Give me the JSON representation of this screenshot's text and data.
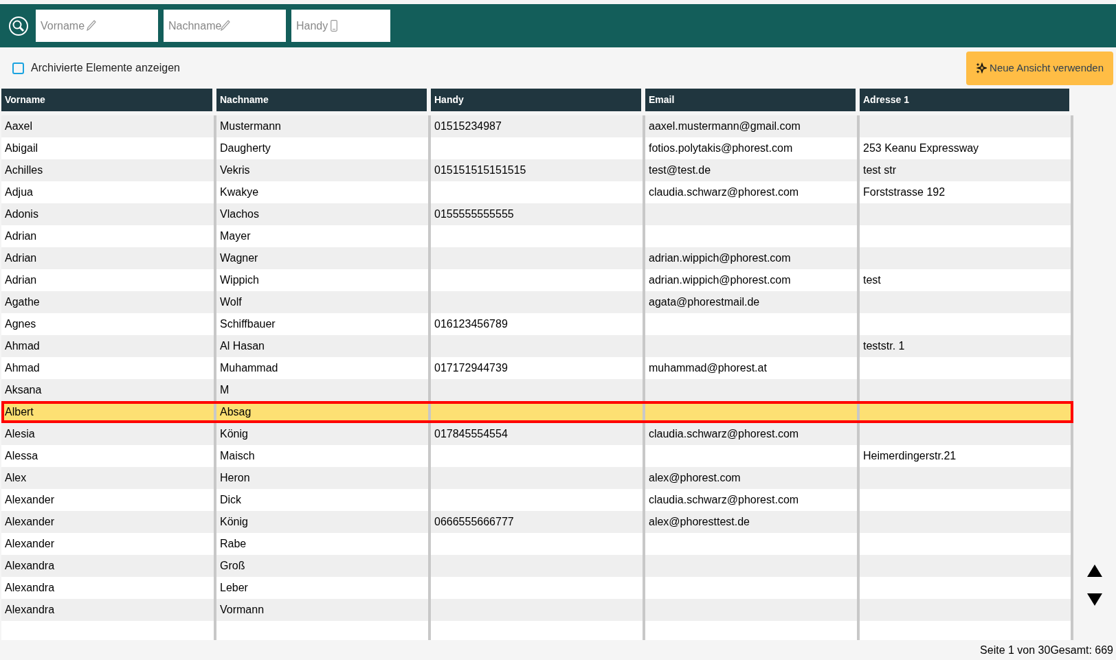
{
  "search": {
    "fields": [
      {
        "placeholder": "Vorname",
        "kind": "pencil"
      },
      {
        "placeholder": "Nachname",
        "kind": "pencil"
      },
      {
        "placeholder": "Handy",
        "kind": "phone"
      }
    ]
  },
  "archive_toggle": {
    "label": "Archivierte Elemente anzeigen",
    "checked": false
  },
  "new_view_button": {
    "label": "Neue Ansicht verwenden"
  },
  "table": {
    "columns": [
      "Vorname",
      "Nachname",
      "Handy",
      "Email",
      "Adresse 1"
    ],
    "rows": [
      {
        "cells": [
          "Aaxel",
          "Mustermann",
          "01515234987",
          "aaxel.mustermann@gmail.com",
          ""
        ],
        "selected": false
      },
      {
        "cells": [
          "Abigail",
          "Daugherty",
          "",
          "fotios.polytakis@phorest.com",
          "253 Keanu Expressway"
        ],
        "selected": false
      },
      {
        "cells": [
          "Achilles",
          "Vekris",
          "015151515151515",
          "test@test.de",
          "test str"
        ],
        "selected": false
      },
      {
        "cells": [
          "Adjua",
          "Kwakye",
          "",
          "claudia.schwarz@phorest.com",
          "Forststrasse 192"
        ],
        "selected": false
      },
      {
        "cells": [
          "Adonis",
          "Vlachos",
          "0155555555555",
          "",
          ""
        ],
        "selected": false
      },
      {
        "cells": [
          "Adrian",
          "Mayer",
          "",
          "",
          ""
        ],
        "selected": false
      },
      {
        "cells": [
          "Adrian",
          "Wagner",
          "",
          "adrian.wippich@phorest.com",
          ""
        ],
        "selected": false
      },
      {
        "cells": [
          "Adrian",
          "Wippich",
          "",
          "adrian.wippich@phorest.com",
          "test"
        ],
        "selected": false
      },
      {
        "cells": [
          "Agathe",
          "Wolf",
          "",
          "agata@phorestmail.de",
          ""
        ],
        "selected": false
      },
      {
        "cells": [
          "Agnes",
          "Schiffbauer",
          "016123456789",
          "",
          ""
        ],
        "selected": false
      },
      {
        "cells": [
          "Ahmad",
          "Al Hasan",
          "",
          "",
          "teststr. 1"
        ],
        "selected": false
      },
      {
        "cells": [
          "Ahmad",
          "Muhammad",
          "017172944739",
          "muhammad@phorest.at",
          ""
        ],
        "selected": false
      },
      {
        "cells": [
          "Aksana",
          "M",
          "",
          "",
          ""
        ],
        "selected": false
      },
      {
        "cells": [
          "Albert",
          "Absag",
          "",
          "",
          ""
        ],
        "selected": true
      },
      {
        "cells": [
          "Alesia",
          "König",
          "017845554554",
          "claudia.schwarz@phorest.com",
          ""
        ],
        "selected": false
      },
      {
        "cells": [
          "Alessa",
          "Maisch",
          "",
          "",
          "Heimerdingerstr.21"
        ],
        "selected": false
      },
      {
        "cells": [
          "Alex",
          "Heron",
          "",
          "alex@phorest.com",
          ""
        ],
        "selected": false
      },
      {
        "cells": [
          "Alexander",
          "Dick",
          "",
          "claudia.schwarz@phorest.com",
          ""
        ],
        "selected": false
      },
      {
        "cells": [
          "Alexander",
          "König",
          "0666555666777",
          "alex@phoresttest.de",
          ""
        ],
        "selected": false
      },
      {
        "cells": [
          "Alexander",
          "Rabe",
          "",
          "",
          ""
        ],
        "selected": false
      },
      {
        "cells": [
          "Alexandra",
          "Groß",
          "",
          "",
          ""
        ],
        "selected": false
      },
      {
        "cells": [
          "Alexandra",
          "Leber",
          "",
          "",
          ""
        ],
        "selected": false
      },
      {
        "cells": [
          "Alexandra",
          "Vormann",
          "",
          "",
          ""
        ],
        "selected": false
      }
    ]
  },
  "pagination": {
    "page": "Seite 1 von 30",
    "total": "Gesamt: 669"
  }
}
